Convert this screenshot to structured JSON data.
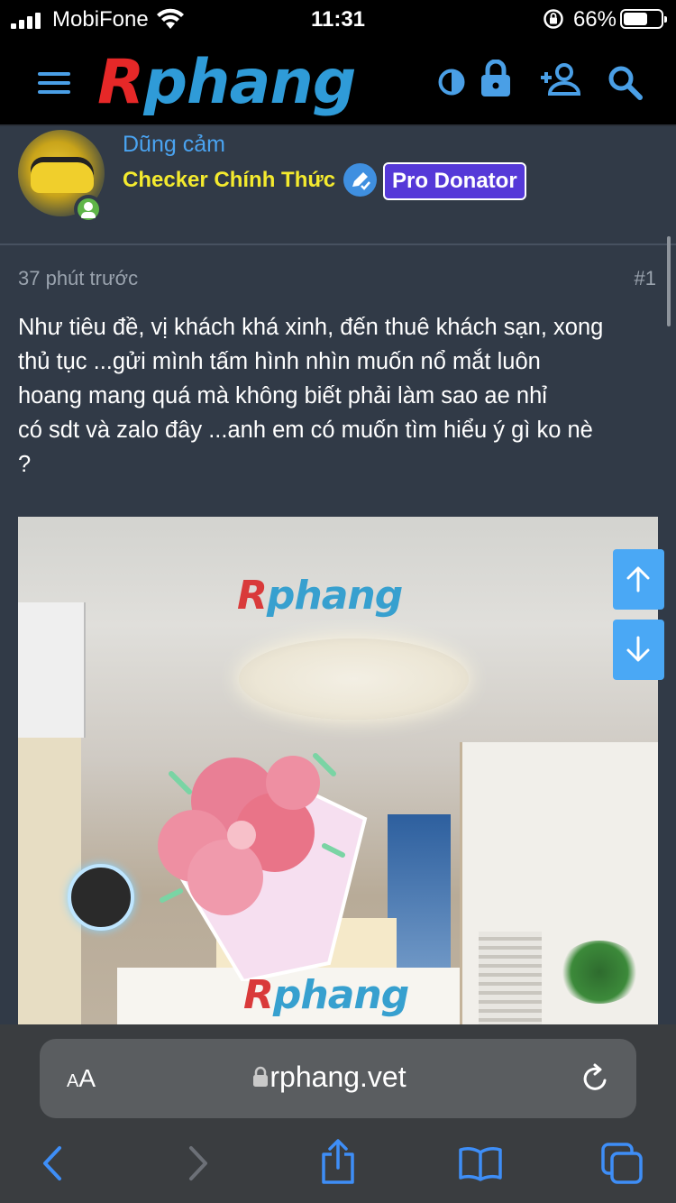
{
  "status_bar": {
    "carrier": "MobiFone",
    "time": "11:31",
    "battery_percent": "66%",
    "battery_level": 0.66
  },
  "header": {
    "logo_r": "R",
    "logo_rest": "phang",
    "icons": [
      "menu-icon",
      "theme-toggle-icon",
      "lock-icon",
      "add-user-icon",
      "search-icon"
    ],
    "accent": "#4a9fe6"
  },
  "user": {
    "name": "Dũng cảm",
    "title": "Checker Chính Thức",
    "badge": "Pro Donator",
    "name_color": "#4aa3f0",
    "title_color": "#f4ea2e",
    "badge_color": "#5539d8"
  },
  "post": {
    "time": "37 phút trước",
    "number": "#1",
    "lines": [
      "Như tiêu đề, vị khách khá xinh, đến thuê khách sạn, xong",
      "thủ tục ...gửi mình tấm hình nhìn muốn nổ mắt luôn",
      "hoang mang quá mà không biết phải làm sao ae nhỉ",
      "có sdt và zalo đây ...anh em có muốn tìm hiểu ý gì ko nè",
      "?"
    ],
    "watermark_r": "R",
    "watermark_rest": "phang"
  },
  "scroll_buttons": {
    "up": "arrow-up-icon",
    "down": "arrow-down-icon"
  },
  "safari": {
    "text_size_big": "A",
    "text_size_small": "A",
    "url": "rphang.vet",
    "toolbar": [
      "back-icon",
      "forward-icon",
      "share-icon",
      "bookmarks-icon",
      "tabs-icon"
    ]
  }
}
